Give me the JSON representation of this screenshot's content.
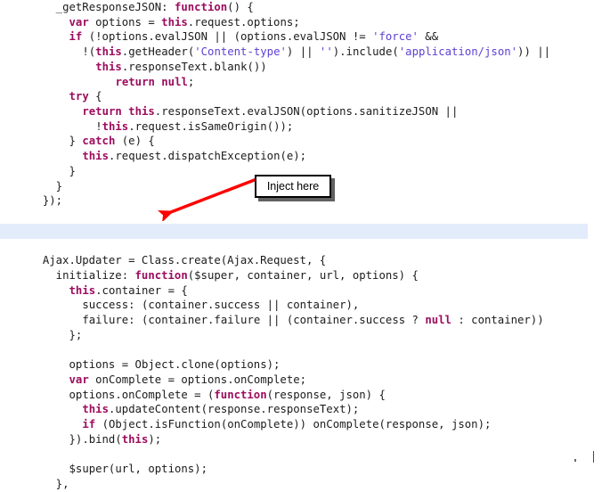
{
  "document": {
    "kind": "source-code-listing",
    "language": "JavaScript",
    "background_color": "#ffffff",
    "highlight_color": "#e3ecfb",
    "keyword_color": "#9c0d5e",
    "string_color": "#5d3fd3",
    "plain_color": "#1b1b1b",
    "annotation_color": "#ff0000"
  },
  "annotation": {
    "callout_label": "Inject here",
    "arrow_icon": "red-arrow-icon",
    "arrow_from": "callout-box",
    "arrow_to": "highlighted-blank-line",
    "border_color": "#000000"
  },
  "code": {
    "lines": [
      {
        "indent": 4,
        "highlight": false,
        "tokens": [
          {
            "t": "plain",
            "s": "_getResponseJSON: "
          },
          {
            "t": "kw",
            "s": "function"
          },
          {
            "t": "plain",
            "s": "() {"
          }
        ]
      },
      {
        "indent": 6,
        "highlight": false,
        "tokens": [
          {
            "t": "kw",
            "s": "var"
          },
          {
            "t": "plain",
            "s": " options = "
          },
          {
            "t": "kw",
            "s": "this"
          },
          {
            "t": "plain",
            "s": ".request.options;"
          }
        ]
      },
      {
        "indent": 6,
        "highlight": false,
        "tokens": [
          {
            "t": "kw",
            "s": "if"
          },
          {
            "t": "plain",
            "s": " (!options.evalJSON || (options.evalJSON != "
          },
          {
            "t": "str",
            "s": "'force'"
          },
          {
            "t": "plain",
            "s": " &&"
          }
        ]
      },
      {
        "indent": 8,
        "highlight": false,
        "tokens": [
          {
            "t": "plain",
            "s": "!("
          },
          {
            "t": "kw",
            "s": "this"
          },
          {
            "t": "plain",
            "s": ".getHeader("
          },
          {
            "t": "str",
            "s": "'Content-type'"
          },
          {
            "t": "plain",
            "s": ") || "
          },
          {
            "t": "str",
            "s": "''"
          },
          {
            "t": "plain",
            "s": ").include("
          },
          {
            "t": "str",
            "s": "'application/json'"
          },
          {
            "t": "plain",
            "s": ")) ||"
          }
        ]
      },
      {
        "indent": 10,
        "highlight": false,
        "tokens": [
          {
            "t": "kw",
            "s": "this"
          },
          {
            "t": "plain",
            "s": ".responseText.blank())"
          }
        ]
      },
      {
        "indent": 13,
        "highlight": false,
        "tokens": [
          {
            "t": "kw",
            "s": "return null"
          },
          {
            "t": "plain",
            "s": ";"
          }
        ]
      },
      {
        "indent": 6,
        "highlight": false,
        "tokens": [
          {
            "t": "kw",
            "s": "try"
          },
          {
            "t": "plain",
            "s": " {"
          }
        ]
      },
      {
        "indent": 8,
        "highlight": false,
        "tokens": [
          {
            "t": "kw",
            "s": "return this"
          },
          {
            "t": "plain",
            "s": ".responseText.evalJSON(options.sanitizeJSON ||"
          }
        ]
      },
      {
        "indent": 10,
        "highlight": false,
        "tokens": [
          {
            "t": "plain",
            "s": "!"
          },
          {
            "t": "kw",
            "s": "this"
          },
          {
            "t": "plain",
            "s": ".request.isSameOrigin());"
          }
        ]
      },
      {
        "indent": 6,
        "highlight": false,
        "tokens": [
          {
            "t": "plain",
            "s": "} "
          },
          {
            "t": "kw",
            "s": "catch"
          },
          {
            "t": "plain",
            "s": " (e) {"
          }
        ]
      },
      {
        "indent": 8,
        "highlight": false,
        "tokens": [
          {
            "t": "kw",
            "s": "this"
          },
          {
            "t": "plain",
            "s": ".request.dispatchException(e);"
          }
        ]
      },
      {
        "indent": 6,
        "highlight": false,
        "tokens": [
          {
            "t": "plain",
            "s": "}"
          }
        ]
      },
      {
        "indent": 4,
        "highlight": false,
        "tokens": [
          {
            "t": "plain",
            "s": "}"
          }
        ]
      },
      {
        "indent": 2,
        "highlight": false,
        "tokens": [
          {
            "t": "plain",
            "s": "});"
          }
        ]
      },
      {
        "indent": 0,
        "highlight": false,
        "tokens": [
          {
            "t": "plain",
            "s": ""
          }
        ]
      },
      {
        "indent": 0,
        "highlight": true,
        "tokens": [
          {
            "t": "plain",
            "s": ""
          }
        ]
      },
      {
        "indent": 0,
        "highlight": false,
        "tokens": [
          {
            "t": "plain",
            "s": ""
          }
        ]
      },
      {
        "indent": 2,
        "highlight": false,
        "tokens": [
          {
            "t": "plain",
            "s": "Ajax.Updater = Class.create(Ajax.Request, {"
          }
        ]
      },
      {
        "indent": 4,
        "highlight": false,
        "tokens": [
          {
            "t": "plain",
            "s": "initialize: "
          },
          {
            "t": "kw",
            "s": "function"
          },
          {
            "t": "plain",
            "s": "($super, container, url, options) {"
          }
        ]
      },
      {
        "indent": 6,
        "highlight": false,
        "tokens": [
          {
            "t": "kw",
            "s": "this"
          },
          {
            "t": "plain",
            "s": ".container = {"
          }
        ]
      },
      {
        "indent": 8,
        "highlight": false,
        "tokens": [
          {
            "t": "plain",
            "s": "success: (container.success || container),"
          }
        ]
      },
      {
        "indent": 8,
        "highlight": false,
        "tokens": [
          {
            "t": "plain",
            "s": "failure: (container.failure || (container.success ? "
          },
          {
            "t": "kw",
            "s": "null"
          },
          {
            "t": "plain",
            "s": " : container))"
          }
        ]
      },
      {
        "indent": 6,
        "highlight": false,
        "tokens": [
          {
            "t": "plain",
            "s": "};"
          }
        ]
      },
      {
        "indent": 0,
        "highlight": false,
        "tokens": [
          {
            "t": "plain",
            "s": ""
          }
        ]
      },
      {
        "indent": 6,
        "highlight": false,
        "tokens": [
          {
            "t": "plain",
            "s": "options = Object.clone(options);"
          }
        ]
      },
      {
        "indent": 6,
        "highlight": false,
        "tokens": [
          {
            "t": "kw",
            "s": "var"
          },
          {
            "t": "plain",
            "s": " onComplete = options.onComplete;"
          }
        ]
      },
      {
        "indent": 6,
        "highlight": false,
        "tokens": [
          {
            "t": "plain",
            "s": "options.onComplete = ("
          },
          {
            "t": "kw",
            "s": "function"
          },
          {
            "t": "plain",
            "s": "(response, json) {"
          }
        ]
      },
      {
        "indent": 8,
        "highlight": false,
        "tokens": [
          {
            "t": "kw",
            "s": "this"
          },
          {
            "t": "plain",
            "s": ".updateContent(response.responseText);"
          }
        ]
      },
      {
        "indent": 8,
        "highlight": false,
        "tokens": [
          {
            "t": "kw",
            "s": "if"
          },
          {
            "t": "plain",
            "s": " (Object.isFunction(onComplete)) onComplete(response, json);"
          }
        ]
      },
      {
        "indent": 6,
        "highlight": false,
        "tokens": [
          {
            "t": "plain",
            "s": "}).bind("
          },
          {
            "t": "kw",
            "s": "this"
          },
          {
            "t": "plain",
            "s": ");"
          }
        ]
      },
      {
        "indent": 0,
        "highlight": false,
        "tokens": [
          {
            "t": "plain",
            "s": ""
          }
        ]
      },
      {
        "indent": 6,
        "highlight": false,
        "tokens": [
          {
            "t": "plain",
            "s": "$super(url, options);"
          }
        ]
      },
      {
        "indent": 4,
        "highlight": false,
        "tokens": [
          {
            "t": "plain",
            "s": "},"
          }
        ]
      }
    ]
  }
}
